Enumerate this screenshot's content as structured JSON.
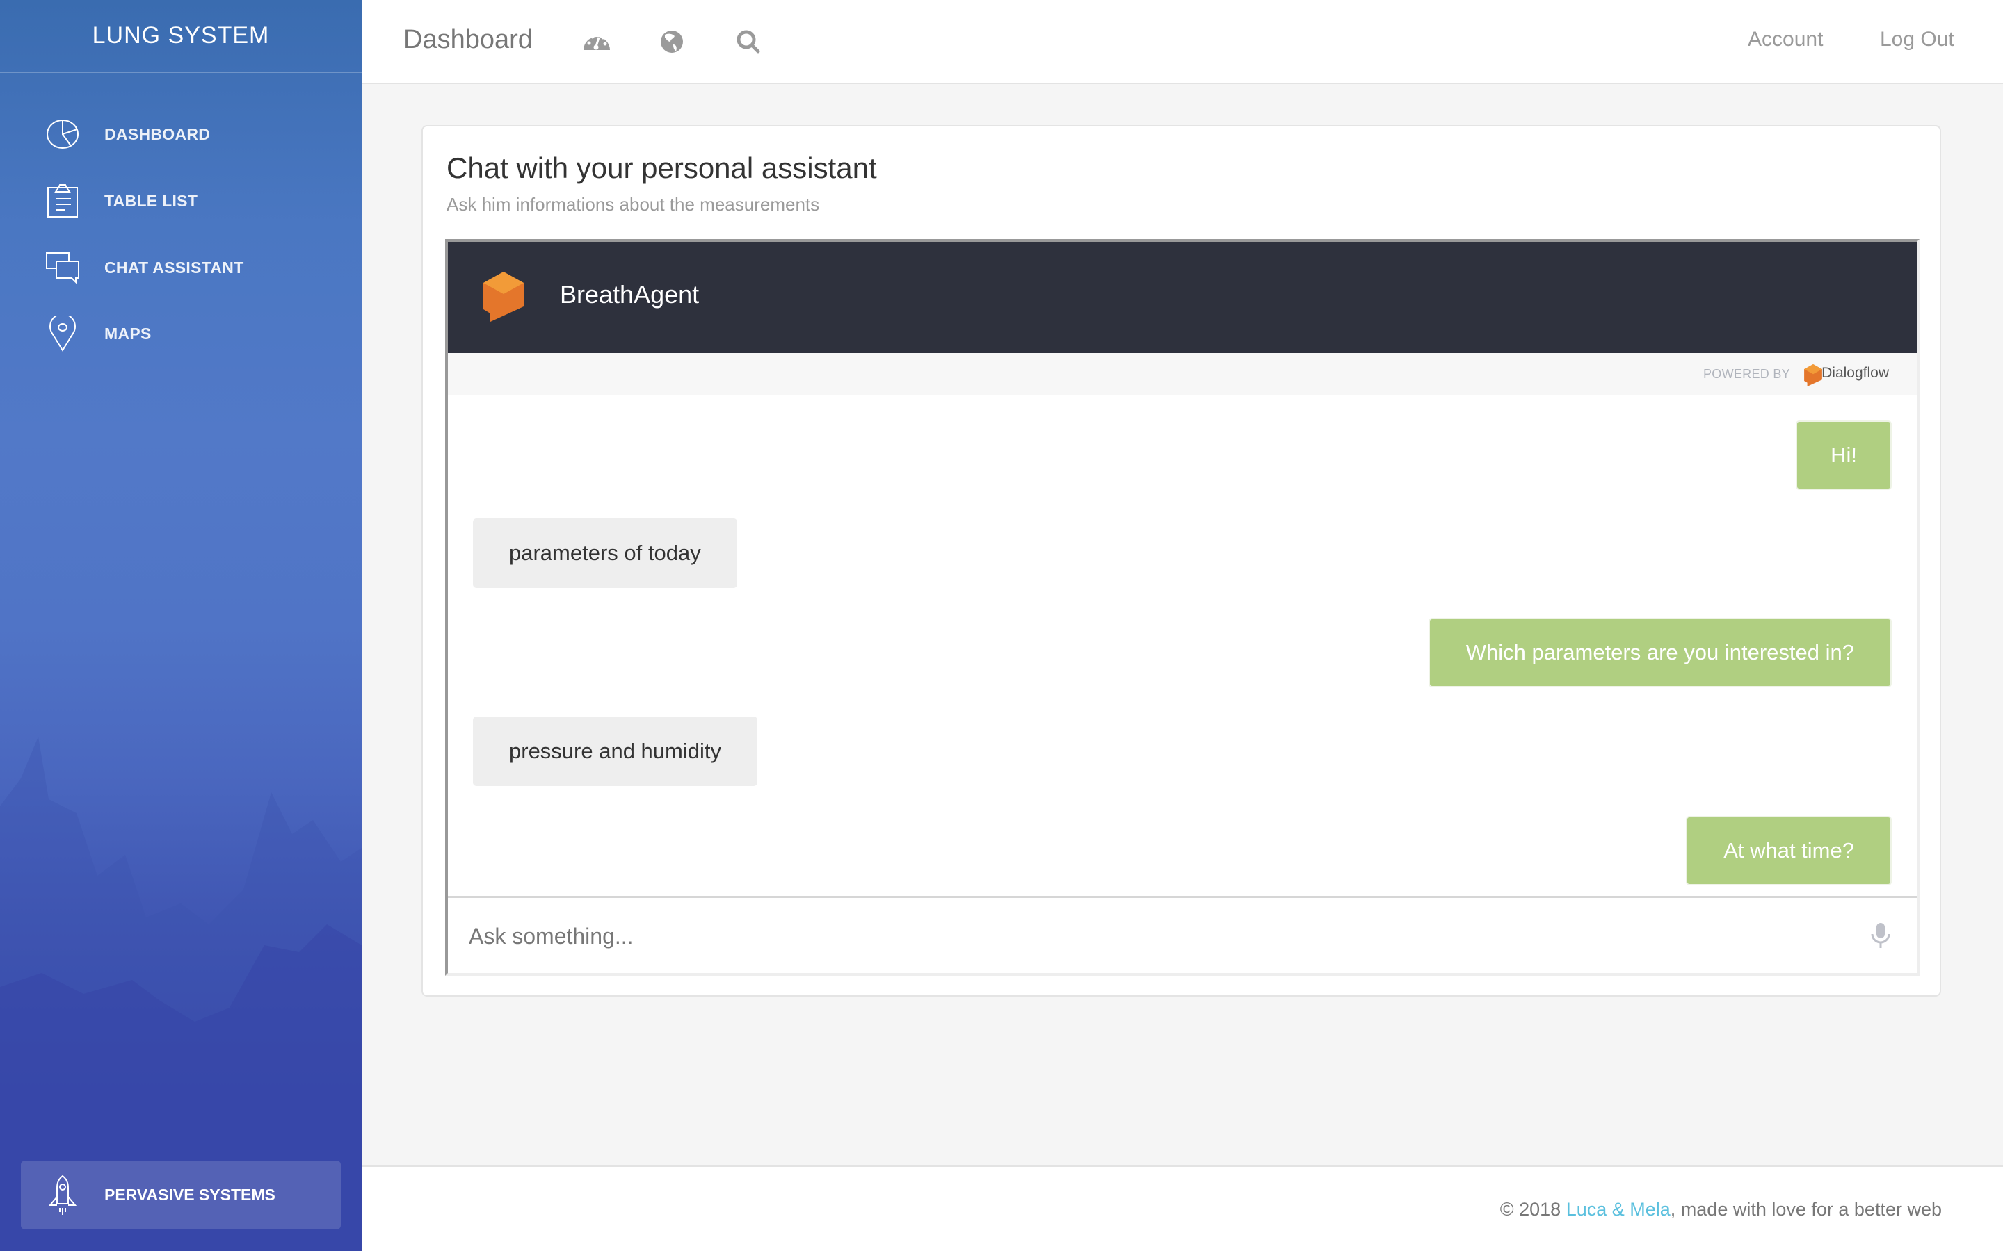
{
  "sidebar": {
    "brand": "LUNG SYSTEM",
    "items": [
      {
        "label": "DASHBOARD",
        "icon": "pie-chart-icon"
      },
      {
        "label": "TABLE LIST",
        "icon": "clipboard-icon"
      },
      {
        "label": "CHAT ASSISTANT",
        "icon": "chat-bubbles-icon"
      },
      {
        "label": "MAPS",
        "icon": "map-pin-icon"
      }
    ],
    "bottom_item": {
      "label": "PERVASIVE SYSTEMS",
      "icon": "rocket-icon"
    }
  },
  "topbar": {
    "title": "Dashboard",
    "icons": [
      "dashboard-gauge-icon",
      "globe-icon",
      "search-icon"
    ],
    "links": {
      "account": "Account",
      "logout": "Log Out"
    }
  },
  "card": {
    "title": "Chat with your personal assistant",
    "subtitle": "Ask him informations about the measurements"
  },
  "chat": {
    "agent_name": "BreathAgent",
    "powered_by": "POWERED BY",
    "provider": "Dialogflow",
    "messages": [
      {
        "from": "bot",
        "text": "Hi!"
      },
      {
        "from": "user",
        "text": "parameters of today"
      },
      {
        "from": "bot",
        "text": "Which parameters are you interested in?"
      },
      {
        "from": "user",
        "text": "pressure and humidity"
      },
      {
        "from": "bot",
        "text": "At what time?"
      }
    ],
    "input": {
      "value": "",
      "placeholder": "Ask something..."
    },
    "colors": {
      "bot_bubble": "#b0cf81",
      "user_bubble": "#eeeeee",
      "header": "#2e313d",
      "logo": "#ef7f2c"
    }
  },
  "footer": {
    "prefix": "© 2018 ",
    "link": "Luca & Mela",
    "suffix": ", made with love for a better web",
    "link_color": "#5bc0de"
  }
}
